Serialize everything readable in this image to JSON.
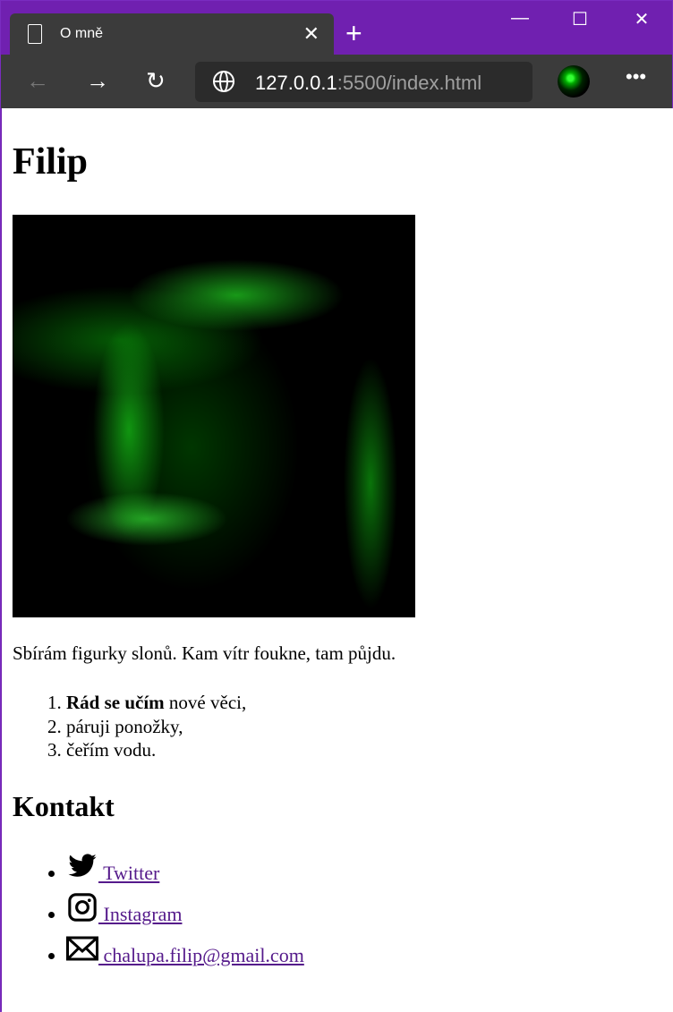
{
  "browser": {
    "tab_title": "O mně",
    "url_host": "127.0.0.1",
    "url_rest": ":5500/index.html",
    "accent_color": "#7020b0"
  },
  "page": {
    "heading": "Filip",
    "bio": "Sbírám figurky slonů. Kam vítr foukne, tam půjdu.",
    "list": [
      {
        "bold": "Rád se učím",
        "text": " nové věci,"
      },
      {
        "text": "páruji ponožky,"
      },
      {
        "text": "čeřím vodu."
      }
    ],
    "contact_heading": "Kontakt",
    "contacts": [
      {
        "icon": "twitter-icon",
        "label": " Twitter"
      },
      {
        "icon": "instagram-icon",
        "label": " Instagram"
      },
      {
        "icon": "mail-icon",
        "label": " chalupa.filip@gmail.com"
      }
    ]
  }
}
